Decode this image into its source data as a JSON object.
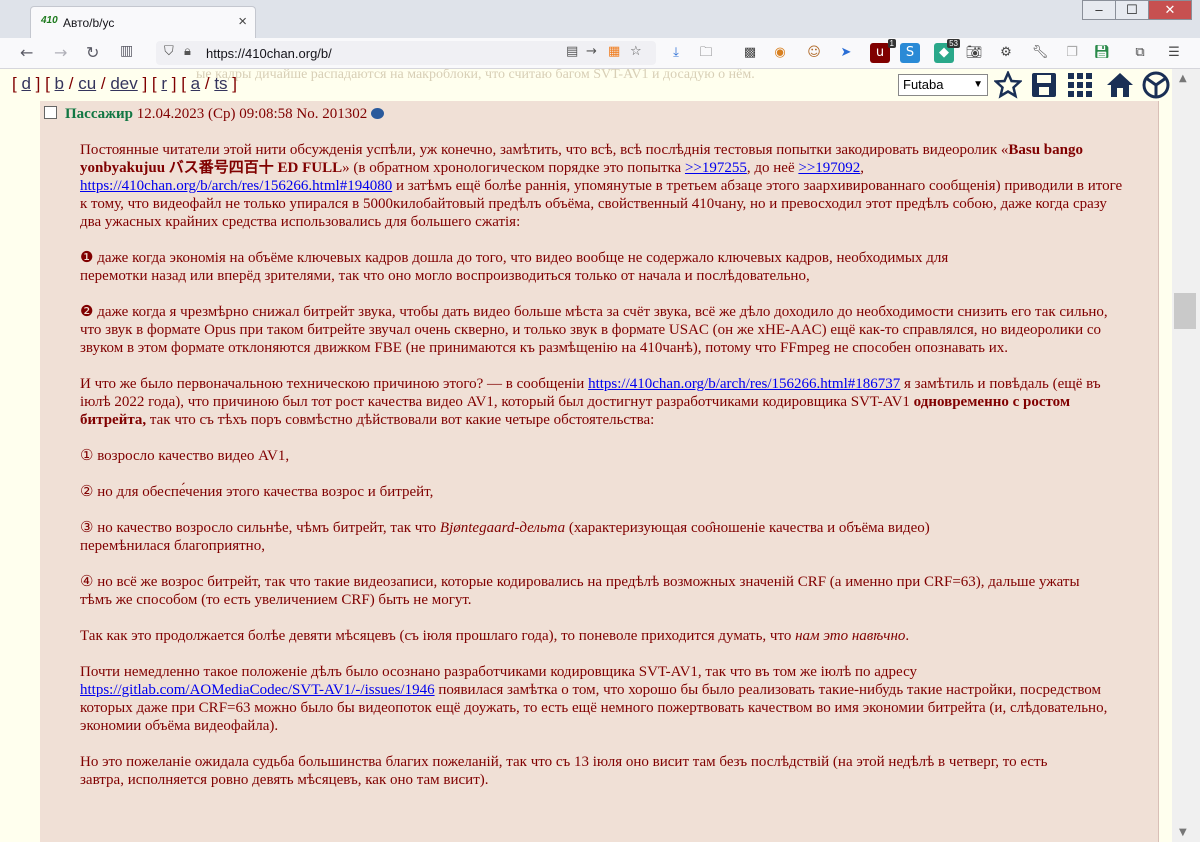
{
  "browser": {
    "tab_title": "Авто/b/ус",
    "tab_favicon": "410",
    "url": "https://410chan.org/b/",
    "window_buttons": {
      "minimize": "–",
      "maximize": "☐",
      "close": "✕"
    }
  },
  "page": {
    "ghost_text": "ые кадры дичайше распадаются на макроблоки, что считаю багом SVT-AV1 и досадую о нём.",
    "boardnav": {
      "groups": [
        [
          "d"
        ],
        [
          "b",
          "cu",
          "dev"
        ],
        [
          "r"
        ],
        [
          "a",
          "ts"
        ]
      ]
    },
    "style_select": "Futaba"
  },
  "post": {
    "name": "Пассажир",
    "date": "12.04.2023 (Ср) 09:08:58",
    "number": "No. 201302",
    "p1": {
      "a": "Постоянные читатели этой нити обсужденія успѣли, уж конечно, замѣтить, что всѣ, всѣ послѣднія тестовыя попытки закодировать видеоролик «",
      "title": "Basu bango yonbyakujuu バス番号四百十 ED FULL",
      "b": "» (в обратном хронологическом порядке это попытка ",
      "link1": ">>197255",
      "c": ", до неё ",
      "link2": ">>197092",
      "d": ", ",
      "link3": "https://410chan.org/b/arch/res/156266.html#194080",
      "e": " и затѣмъ ещё болѣе раннія, упомянутые в третьем абзаце этого заархивированнаго сообщенія) приводили в итоге к тому, что видеофайл не только упирался в 5000килобайтовый предѣлъ объёма, свойственный 410чану, но и превосходил этот предѣлъ собою, даже когда сразу два ужасных крайних средства использовались для большего сжатія:"
    },
    "p2": {
      "marker": "❶",
      "text": " даже когда экономія на объёме ключевых кадров дошла до того, что видео вообще не содержало ключевых кадров, необходимых для перемотки назад или вперёд зрителями, так что оно могло воспроизводиться только от начала и послѣдовательно,"
    },
    "p3": {
      "marker": "❷",
      "text": " даже когда я чрезмѣрно снижал битрейт звука, чтобы дать видео больше мѣста за счёт звука, всё же дѣло доходило до необходимости снизить его так сильно, что звук в формате Opus при таком битрейте звучал очень скверно, и только звук в формате USAC (он же xHE-AAC) ещё как-то справлялся, но видеоролики со звуком в этом формате отклоняются движком FBE (не принимаются къ размѣщенію на 410чанѣ), потому что FFmpeg не способен опознавать их."
    },
    "p4": {
      "a": "И что же было первоначальною техническою причиною этого? — в сообщеніи ",
      "link": "https://410chan.org/b/arch/res/156266.html#186737",
      "b": " я замѣтиль и повѣдаль (ещё въ іюлѣ 2022 года), что причиною был тот рост качества видео AV1, который был достигнут разработчиками кодировщика SVT-AV1 ",
      "bold": "одновременно с ростом битрейта,",
      "c": " так что съ тѣхъ поръ совмѣстно дѣйствовали вот какие четыре обстоятельства:"
    },
    "items": [
      {
        "marker": "①",
        "text": " возросло качество видео AV1,"
      },
      {
        "marker": "②",
        "text": " но для обеспе́чения этого качества возрос и битрейт,"
      },
      {
        "marker": "③",
        "text": " но качество возросло сильнѣе, чѣмъ битрейт, так что ",
        "em": "Bjøntegaard-дельта",
        "tail": " (характеризующая соо̂ношеніе качества и объёма видео) перемѣнилася благоприятно,"
      },
      {
        "marker": "④",
        "text": " но всё же возрос битрейт, так что такие видеозаписи, которые кодировались на предѣлѣ возможных значеній CRF (а именно при CRF=63), дальше ужаты тѣмъ же способом (то есть увеличением CRF) быть не могут."
      }
    ],
    "p5": {
      "a": "Так как это продолжается болѣе девяти мѣсяцевъ (съ іюля прошлаго года), то поневоле приходится думать, что ",
      "em": "нам это навѣчно",
      "b": "."
    },
    "p6": {
      "a": "Почти немедленно такое положеніе дѣлъ было осознано разработчиками кодировщика SVT-AV1, так что въ том же іюлѣ по адресу ",
      "link": "https://gitlab.com/AOMediaCodec/SVT-AV1/-/issues/1946",
      "b": " появилася замѣтка о том, что хорошо бы было реализовать такие-нибудь такие настройки, посредством которых даже при CRF=63 можно было бы видеопоток ещё доужать, то есть ещё немного пожертвовать качеством во имя экономии битрейта (и, слѣдовательно, экономии объёма видеофайла)."
    },
    "p7": {
      "text": "Но это пожеланіе ожидала судьба большинства благих пожеланій, так что съ 13 іюля оно висит там безъ послѣдствій (на этой недѣлѣ в четверг, то есть завтра, исполняется ровно девять мѣсяцевъ, как оно там висит)."
    }
  }
}
